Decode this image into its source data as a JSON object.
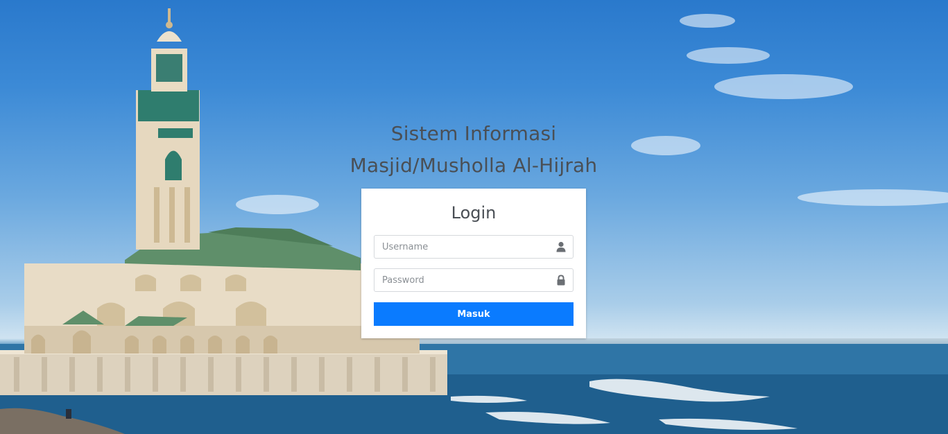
{
  "header": {
    "title_line1": "Sistem Informasi",
    "title_line2": "Masjid/Musholla Al-Hijrah"
  },
  "login": {
    "title": "Login",
    "username": {
      "placeholder": "Username",
      "value": "",
      "icon": "user-icon"
    },
    "password": {
      "placeholder": "Password",
      "value": "",
      "icon": "lock-icon"
    },
    "submit_label": "Masuk"
  },
  "colors": {
    "button": "#0a7bff",
    "text": "#4a4f55"
  }
}
